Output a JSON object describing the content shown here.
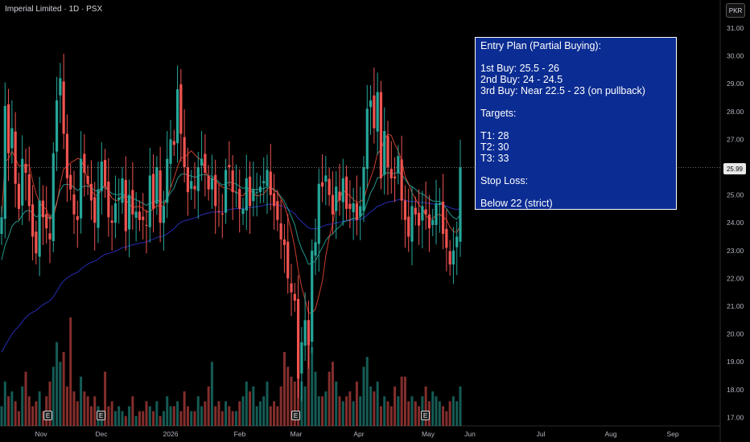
{
  "header": {
    "title": "Imperial Limited · 1D · PSX",
    "currency": "PKR"
  },
  "last_price": "25.99",
  "earnings_marker": "E",
  "annotation": {
    "lines": [
      "Entry Plan (Partial Buying):",
      "",
      "1st Buy: 25.5 - 26",
      "2nd Buy: 24 - 24.5",
      "3rd Buy: Near 22.5 - 23 (on pullback)",
      "",
      "Targets:",
      "",
      "T1: 28",
      "T2: 30",
      "T3: 33",
      "",
      "Stop Loss:",
      "",
      "Below 22 (strict)"
    ]
  },
  "colors": {
    "up": "#26a69a",
    "down": "#ef5350",
    "ma_short": "#e0452f",
    "ma_mid": "#26a69a",
    "ma_long": "#2a32c8",
    "annotation_bg": "#0b2c92",
    "background": "#000000"
  },
  "chart_data": {
    "type": "candlestick",
    "y_axis_ticks": [
      31,
      30,
      29,
      28,
      27,
      26,
      25,
      24,
      23,
      22,
      21,
      20,
      19,
      18,
      17
    ],
    "y_tick_labels": [
      "31.00",
      "30.00",
      "29.00",
      "28.00",
      "27.00",
      "26.00",
      "25.00",
      "24.00",
      "23.00",
      "22.00",
      "21.00",
      "20.00",
      "19.00",
      "18.00",
      "17.00"
    ],
    "ylim": [
      16.6,
      31.6
    ],
    "x_axis_labels": [
      "Nov",
      "Dec",
      "2026",
      "Feb",
      "Mar",
      "Apr",
      "May",
      "Jun",
      "Jul",
      "Aug",
      "Sep"
    ],
    "last_close": 25.99,
    "closes": [
      24.2,
      28.2,
      26.5,
      27.4,
      25.4,
      24.5,
      26.3,
      25.8,
      24.6,
      23.5,
      22.9,
      24.8,
      24.2,
      23.8,
      23.4,
      26.5,
      28.4,
      29.2,
      27.2,
      25.6,
      25.2,
      24.3,
      24.1,
      26.3,
      25.8,
      25.4,
      24.8,
      24.0,
      25.2,
      26.2,
      25.3,
      24.2,
      24.0,
      24.7,
      24.9,
      25.6,
      23.7,
      25.0,
      24.3,
      24.4,
      24.1,
      24.1,
      23.9,
      25.7,
      24.5,
      26.0,
      24.0,
      24.6,
      26.3,
      27.0,
      26.8,
      28.8,
      27.2,
      26.0,
      25.1,
      25.5,
      25.2,
      26.0,
      26.3,
      25.8,
      25.2,
      25.6,
      24.6,
      24.4,
      24.3,
      25.9,
      26.0,
      25.1,
      25.1,
      24.5,
      24.5,
      25.6,
      24.6,
      25.2,
      25.1,
      25.3,
      25.5,
      25.9,
      25.0,
      24.6,
      24.1,
      23.4,
      23.2,
      22.0,
      21.5,
      21.2,
      18.4,
      19.7,
      20.5,
      19.6,
      23.0,
      23.3,
      25.4,
      25.3,
      25.7,
      25.0,
      24.3,
      25.3,
      24.8,
      25.6,
      24.5,
      24.5,
      24.7,
      24.1,
      24.6,
      26.0,
      28.1,
      28.4,
      27.4,
      28.7,
      25.6,
      27.3,
      26.0,
      25.6,
      25.6,
      26.4,
      24.8,
      24.1,
      23.5,
      24.6,
      24.3,
      23.9,
      24.6,
      24.3,
      23.8,
      24.1,
      24.7,
      24.7,
      23.6,
      23.1,
      22.5,
      23.0,
      23.5,
      25.99
    ],
    "volumes": [
      4,
      9,
      6,
      7,
      5,
      3,
      8,
      11,
      6,
      4,
      5,
      7,
      3,
      6,
      9,
      12,
      17,
      13,
      15,
      8,
      22,
      7,
      5,
      10,
      7,
      6,
      4,
      6,
      4,
      3,
      11,
      4,
      5,
      3,
      4,
      3,
      2,
      4,
      6,
      2,
      3,
      3,
      5,
      4,
      3,
      5,
      2,
      3,
      6,
      4,
      4,
      5,
      3,
      7,
      4,
      3,
      3,
      6,
      4,
      5,
      8,
      13,
      4,
      5,
      3,
      5,
      4,
      3,
      3,
      5,
      6,
      9,
      7,
      8,
      4,
      5,
      6,
      9,
      4,
      5,
      4,
      8,
      15,
      12,
      10,
      9,
      18,
      9,
      8,
      17,
      16,
      11,
      6,
      6,
      7,
      11,
      13,
      9,
      6,
      5,
      6,
      7,
      5,
      9,
      6,
      12,
      14,
      8,
      7,
      9,
      4,
      6,
      5,
      4,
      8,
      6,
      10,
      10,
      5,
      6,
      5,
      4,
      6,
      8,
      5,
      7,
      6,
      5,
      4,
      3,
      5,
      6,
      5,
      8
    ]
  }
}
